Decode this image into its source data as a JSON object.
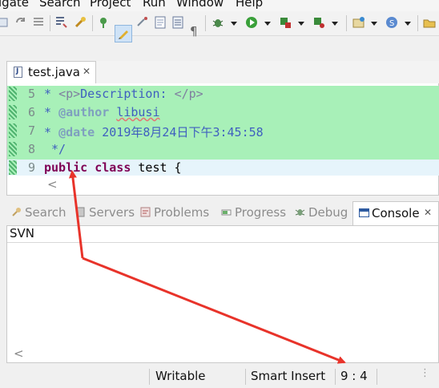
{
  "menu": [
    "igate",
    "Search",
    "Project",
    "Run",
    "Window",
    "Help"
  ],
  "toolbar": {
    "icons": [
      "outline-icon",
      "refresh-icon",
      "list-icon",
      "build-icon",
      "pin-icon",
      "highlight-icon",
      "next-annotation-icon",
      "block-select-icon",
      "whitespace-icon",
      "debug-icon",
      "run-icon",
      "coverage-icon",
      "external-tools-icon",
      "new-wizard-icon",
      "open-type-icon",
      "open-task-icon"
    ]
  },
  "editor": {
    "tab_title": "test.java",
    "close_glyph": "✕",
    "lines": [
      {
        "num": "5",
        "text": "* <p>Description: </p>"
      },
      {
        "num": "6",
        "text": "* @author libusi"
      },
      {
        "num": "7",
        "text": "* @date 2019年8月24日下午3:45:58"
      },
      {
        "num": "8",
        "text": " */"
      },
      {
        "num": "9",
        "text": "public class test {"
      }
    ],
    "scroll_arrow": "<"
  },
  "views": {
    "tabs": [
      {
        "label": "Search",
        "icon": "search-icon"
      },
      {
        "label": "Servers",
        "icon": "servers-icon"
      },
      {
        "label": "Problems",
        "icon": "problems-icon"
      },
      {
        "label": "Progress",
        "icon": "progress-icon"
      },
      {
        "label": "Debug",
        "icon": "debug-icon"
      }
    ],
    "console_tab": "Console",
    "close_glyph": "✕"
  },
  "console": {
    "header": "SVN",
    "scroll_arrow": "<"
  },
  "status": {
    "writable": "Writable",
    "insert_mode": "Smart Insert",
    "position": "9 : 4"
  },
  "colors": {
    "highlight": "#a8f0b8",
    "current_line": "#e6f4fb",
    "keyword": "#7f0055",
    "comment": "#3f5fbf",
    "arrow": "#e8332a"
  }
}
